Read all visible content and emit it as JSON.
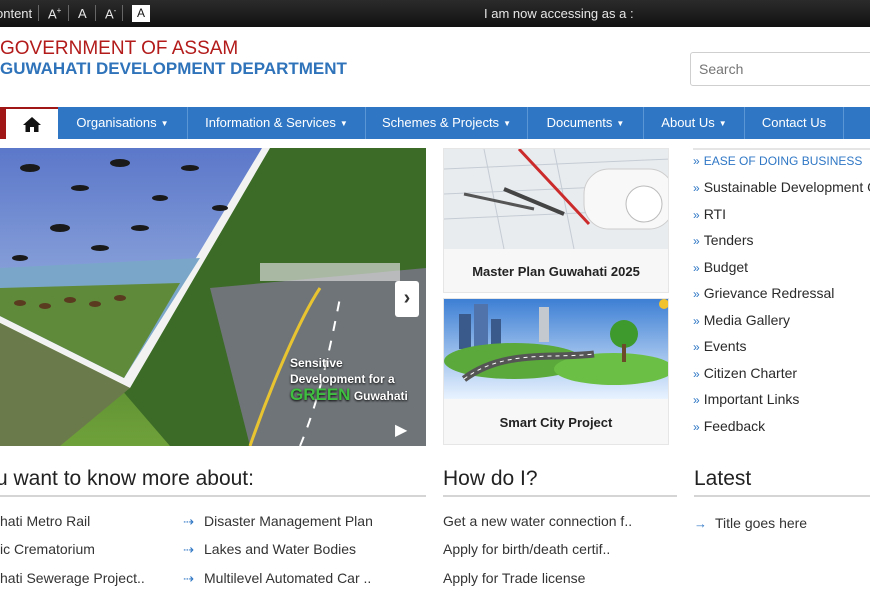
{
  "topbar": {
    "skip_label": "ontent",
    "font_increase": "A",
    "font_increase_sup": "+",
    "font_normal": "A",
    "font_decrease": "A",
    "font_decrease_sup": "-",
    "contrast_label": "A",
    "access_text": "I am now accessing as a :"
  },
  "header": {
    "line1": "GOVERNMENT OF ASSAM",
    "line2": "GUWAHATI DEVELOPMENT DEPARTMENT",
    "search_placeholder": "Search"
  },
  "nav": {
    "items": [
      {
        "label": "Organisations"
      },
      {
        "label": "Information & Services"
      },
      {
        "label": "Schemes & Projects"
      },
      {
        "label": "Documents"
      },
      {
        "label": "About Us"
      },
      {
        "label": "Contact Us"
      }
    ]
  },
  "banner": {
    "caption_line1": "Sensitive",
    "caption_line2": "Development for a",
    "caption_green": "GREEN",
    "caption_city": "Guwahati"
  },
  "cards": [
    {
      "label": "Master Plan Guwahati 2025"
    },
    {
      "label": "Smart City Project"
    }
  ],
  "quick_links": [
    "EASE OF DOING BUSINESS",
    "Sustainable Development G",
    "RTI",
    "Tenders",
    "Budget",
    "Grievance Redressal",
    "Media Gallery",
    "Events",
    "Citizen Charter",
    "Important Links",
    "Feedback"
  ],
  "know_more": {
    "title": "u want to know more about:",
    "left": [
      "hati Metro Rail",
      "ic Crematorium",
      "hati Sewerage Project.."
    ],
    "right": [
      "Disaster Management Plan",
      "Lakes and Water Bodies",
      "Multilevel Automated Car .."
    ]
  },
  "how_do_i": {
    "title": "How do I?",
    "items": [
      "Get a new water connection f..",
      "Apply for birth/death certif..",
      "Apply for Trade license"
    ]
  },
  "latest": {
    "title": "Latest",
    "items": [
      "Title goes here"
    ]
  }
}
